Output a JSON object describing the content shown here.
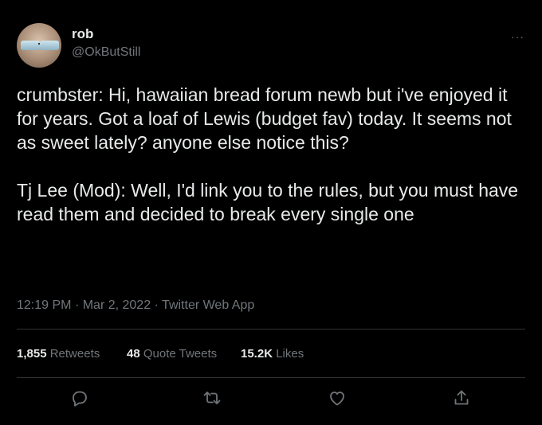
{
  "author": {
    "display_name": "rob",
    "handle": "@OkButStill",
    "avatar_icon": "avatar-sunglasses"
  },
  "more_label": "···",
  "tweet": {
    "paragraphs": [
      "crumbster: Hi, hawaiian bread forum newb but i've enjoyed it for years. Got a loaf of Lewis (budget fav) today. It seems not as sweet lately? anyone else notice this?",
      "Tj Lee (Mod): Well, I'd link you to the rules, but you must have read them and decided to break every single one"
    ],
    "time": "12:19 PM",
    "date": "Mar 2, 2022",
    "source": "Twitter Web App",
    "separator": "·"
  },
  "stats": {
    "retweets_count": "1,855",
    "retweets_label": "Retweets",
    "quotes_count": "48",
    "quotes_label": "Quote Tweets",
    "likes_count": "15.2K",
    "likes_label": "Likes"
  },
  "actions": [
    "reply-icon",
    "retweet-icon",
    "like-icon",
    "share-icon"
  ],
  "colors": {
    "background": "#000000",
    "text": "#e7e9ea",
    "secondary": "#71767b",
    "divider": "#2f3336"
  }
}
